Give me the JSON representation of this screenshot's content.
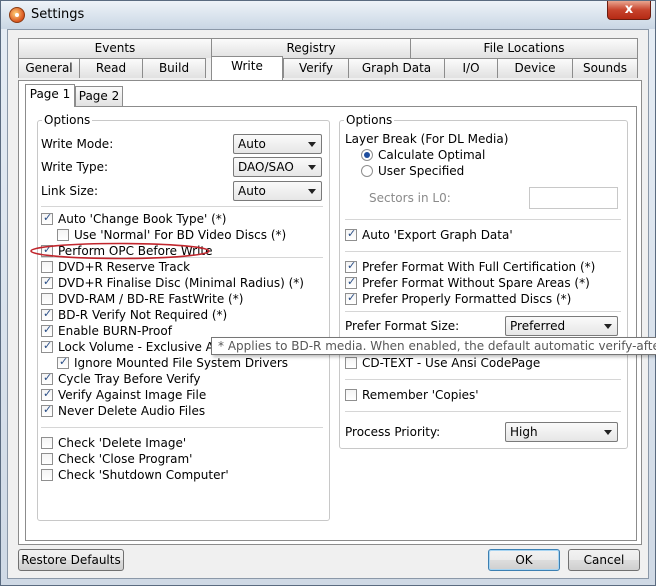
{
  "window": {
    "title": "Settings",
    "close_glyph": "x"
  },
  "tabs": {
    "row1": [
      "Events",
      "Registry",
      "File Locations"
    ],
    "row2": [
      "General",
      "Read",
      "Build",
      "Write",
      "Verify",
      "Graph Data",
      "I/O",
      "Device",
      "Sounds"
    ],
    "selected": "Write"
  },
  "subtabs": [
    "Page 1",
    "Page 2"
  ],
  "left": {
    "legend": "Options",
    "write_mode": {
      "label": "Write Mode:",
      "value": "Auto"
    },
    "write_type": {
      "label": "Write Type:",
      "value": "DAO/SAO"
    },
    "link_size": {
      "label": "Link Size:",
      "value": "Auto"
    },
    "checks": [
      {
        "label": "Auto 'Change Book Type' (*)",
        "checked": true
      },
      {
        "label": "Use 'Normal' For BD Video Discs (*)",
        "checked": false
      },
      {
        "label": "Perform OPC Before Write",
        "checked": true
      },
      {
        "label": "DVD+R Reserve Track",
        "checked": false
      },
      {
        "label": "DVD+R Finalise Disc (Minimal Radius) (*)",
        "checked": true
      },
      {
        "label": "DVD-RAM / BD-RE FastWrite (*)",
        "checked": false
      },
      {
        "label": "BD-R Verify Not Required (*)",
        "checked": true
      },
      {
        "label": "Enable BURN-Proof",
        "checked": true
      },
      {
        "label": "Lock Volume - Exclusive Access",
        "checked": true
      },
      {
        "label": "Ignore Mounted File System Drivers",
        "checked": true
      },
      {
        "label": "Cycle Tray Before Verify",
        "checked": true
      },
      {
        "label": "Verify Against Image File",
        "checked": true
      },
      {
        "label": "Never Delete Audio Files",
        "checked": true
      },
      {
        "label": "Check 'Delete Image'",
        "checked": false
      },
      {
        "label": "Check 'Close Program'",
        "checked": false
      },
      {
        "label": "Check 'Shutdown Computer'",
        "checked": false
      }
    ]
  },
  "right": {
    "legend": "Options",
    "layer_break": "Layer Break (For DL Media)",
    "radio_optimal": "Calculate Optimal",
    "radio_user": "User Specified",
    "sectors_label": "Sectors in L0:",
    "auto_export": {
      "label": "Auto 'Export Graph Data'",
      "checked": true
    },
    "prefer_cert": {
      "label": "Prefer Format With Full Certification (*)",
      "checked": true
    },
    "prefer_nospare": {
      "label": "Prefer Format Without Spare Areas (*)",
      "checked": true
    },
    "prefer_proper": {
      "label": "Prefer Properly Formatted Discs (*)",
      "checked": true
    },
    "prefer_size": {
      "label": "Prefer Format Size:",
      "value": "Preferred"
    },
    "cdtext": {
      "label": "CD-TEXT - Use Ansi CodePage",
      "checked": false
    },
    "remember": {
      "label": "Remember 'Copies'",
      "checked": false
    },
    "priority": {
      "label": "Process Priority:",
      "value": "High"
    }
  },
  "tooltip": "* Applies to BD-R media. When enabled, the default automatic verify-after-write function",
  "buttons": {
    "restore": "Restore Defaults",
    "ok": "OK",
    "cancel": "Cancel"
  },
  "colors": {
    "annotation": "#c0262d",
    "checkmark": "#2a4e86"
  }
}
